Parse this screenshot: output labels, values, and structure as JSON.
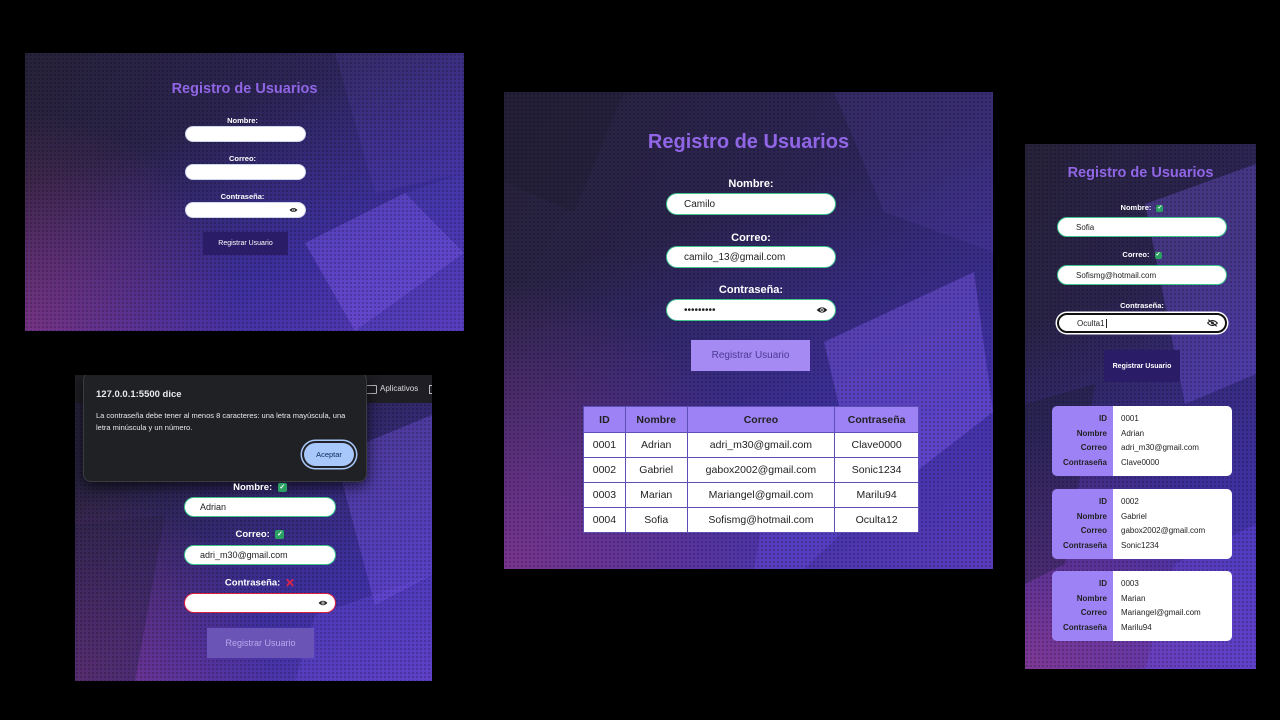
{
  "panel1": {
    "title": "Registro de Usuarios",
    "name_label": "Nombre:",
    "email_label": "Correo:",
    "password_label": "Contraseña:",
    "name_value": "",
    "email_value": "",
    "password_value": "",
    "submit_label": "Registrar Usuario"
  },
  "panel2": {
    "browser_folder": "Aplicativos",
    "dialog": {
      "origin": "127.0.0.1:5500 dice",
      "message": "La contraseña debe tener al menos 8 caracteres: una letra mayúscula, una letra minúscula y un número.",
      "accept_label": "Aceptar"
    },
    "name_label": "Nombre:",
    "email_label": "Correo:",
    "password_label": "Contraseña:",
    "name_value": "Adrian",
    "email_value": "adri_m30@gmail.com",
    "password_value": "",
    "name_valid": true,
    "email_valid": true,
    "password_valid": false,
    "submit_label": "Registrar Usuario"
  },
  "panel3": {
    "title": "Registro de Usuarios",
    "name_label": "Nombre:",
    "email_label": "Correo:",
    "password_label": "Contraseña:",
    "name_value": "Camilo",
    "email_value": "camilo_13@gmail.com",
    "password_value": "•••••••••",
    "submit_label": "Registrar Usuario",
    "table": {
      "headers": [
        "ID",
        "Nombre",
        "Correo",
        "Contraseña"
      ],
      "rows": [
        [
          "0001",
          "Adrian",
          "adri_m30@gmail.com",
          "Clave0000"
        ],
        [
          "0002",
          "Gabriel",
          "gabox2002@gmail.com",
          "Sonic1234"
        ],
        [
          "0003",
          "Marian",
          "Mariangel@gmail.com",
          "Marilu94"
        ],
        [
          "0004",
          "Sofia",
          "Sofismg@hotmail.com",
          "Oculta12"
        ]
      ]
    }
  },
  "panel4": {
    "title": "Registro de Usuarios",
    "name_label": "Nombre:",
    "email_label": "Correo:",
    "password_label": "Contraseña:",
    "name_value": "Sofia",
    "email_value": "Sofismg@hotmail.com",
    "password_value": "Oculta1",
    "submit_label": "Registrar Usuario",
    "card_keys": [
      "ID",
      "Nombre",
      "Correo",
      "Contraseña"
    ],
    "cards": [
      [
        "0001",
        "Adrian",
        "adri_m30@gmail.com",
        "Clave0000"
      ],
      [
        "0002",
        "Gabriel",
        "gabox2002@gmail.com",
        "Sonic1234"
      ],
      [
        "0003",
        "Marian",
        "Mariangel@gmail.com",
        "Marilu94"
      ]
    ]
  },
  "colors": {
    "title": "#9166e6",
    "button_primary": "#2a1c66",
    "button_light": "#a58af3",
    "button_disabled": "#6a54b5",
    "table_header": "#9d82f6",
    "valid": "#2aa062",
    "invalid": "#e0244a"
  },
  "icons": {
    "show_password": "eye-icon",
    "hide_password": "eye-slash-icon",
    "valid": "check-icon",
    "invalid": "cross-icon",
    "folder": "folder-icon"
  }
}
